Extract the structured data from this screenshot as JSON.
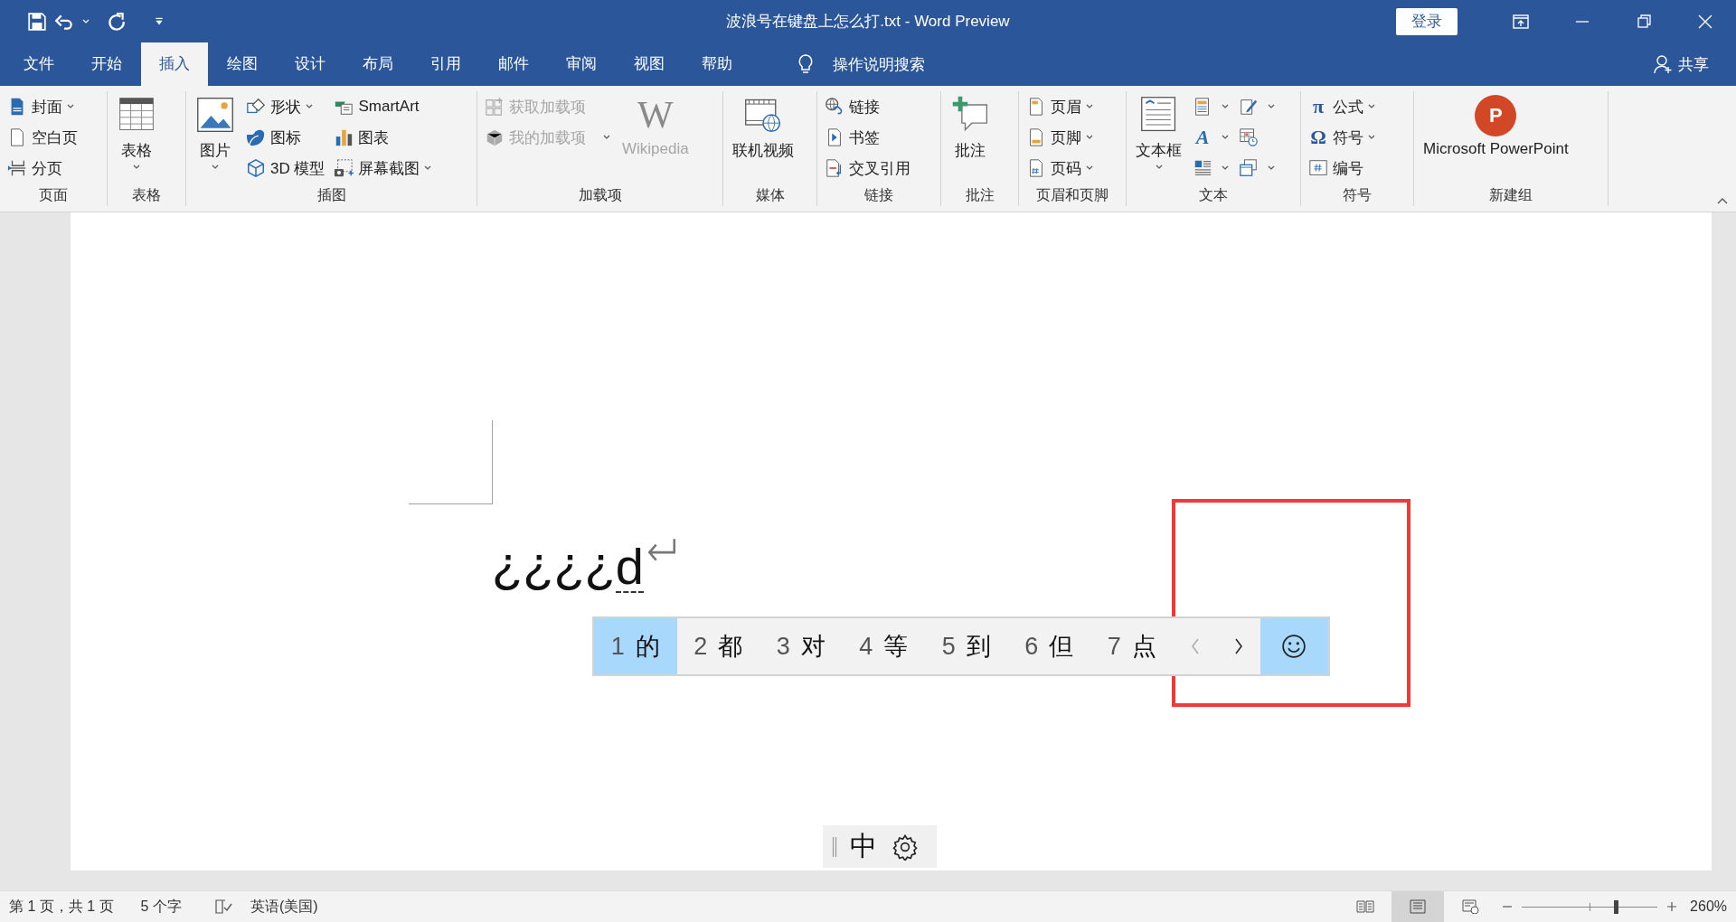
{
  "window": {
    "title": "波浪号在键盘上怎么打.txt  -  Word Preview",
    "sign_in": "登录"
  },
  "tabs": [
    {
      "label": "文件",
      "selected": false
    },
    {
      "label": "开始",
      "selected": false
    },
    {
      "label": "插入",
      "selected": true
    },
    {
      "label": "绘图",
      "selected": false
    },
    {
      "label": "设计",
      "selected": false
    },
    {
      "label": "布局",
      "selected": false
    },
    {
      "label": "引用",
      "selected": false
    },
    {
      "label": "邮件",
      "selected": false
    },
    {
      "label": "审阅",
      "selected": false
    },
    {
      "label": "视图",
      "selected": false
    },
    {
      "label": "帮助",
      "selected": false
    }
  ],
  "tell_me": "操作说明搜索",
  "share": "共享",
  "ribbon": {
    "groups": [
      {
        "label": "页面",
        "items": [
          {
            "kind": "small",
            "label": "封面",
            "dropdown": true,
            "disabled": false
          },
          {
            "kind": "small",
            "label": "空白页",
            "dropdown": false,
            "disabled": false
          },
          {
            "kind": "small",
            "label": "分页",
            "dropdown": false,
            "disabled": false
          }
        ]
      },
      {
        "label": "表格",
        "items": [
          {
            "kind": "large",
            "label": "表格",
            "dropdown": true,
            "disabled": false
          }
        ]
      },
      {
        "label": "插图",
        "items": [
          {
            "kind": "large",
            "label": "图片",
            "dropdown": true,
            "disabled": false
          },
          {
            "kind": "small",
            "label": "形状",
            "dropdown": true,
            "disabled": false
          },
          {
            "kind": "small",
            "label": "图标",
            "dropdown": false,
            "disabled": false
          },
          {
            "kind": "small",
            "label": "3D 模型",
            "dropdown": false,
            "disabled": false
          },
          {
            "kind": "small",
            "label": "SmartArt",
            "dropdown": false,
            "disabled": false
          },
          {
            "kind": "small",
            "label": "图表",
            "dropdown": false,
            "disabled": false
          },
          {
            "kind": "small",
            "label": "屏幕截图",
            "dropdown": true,
            "disabled": false
          }
        ]
      },
      {
        "label": "加载项",
        "items": [
          {
            "kind": "small",
            "label": "获取加载项",
            "dropdown": false,
            "disabled": true
          },
          {
            "kind": "small",
            "label": "我的加载项",
            "dropdown": true,
            "disabled": true
          },
          {
            "kind": "large",
            "label": "Wikipedia",
            "glyph": "W",
            "dropdown": false,
            "disabled": true
          }
        ]
      },
      {
        "label": "媒体",
        "items": [
          {
            "kind": "large",
            "label": "联机视频",
            "dropdown": false,
            "disabled": false
          }
        ]
      },
      {
        "label": "链接",
        "items": [
          {
            "kind": "small",
            "label": "链接",
            "dropdown": false,
            "disabled": false
          },
          {
            "kind": "small",
            "label": "书签",
            "dropdown": false,
            "disabled": false
          },
          {
            "kind": "small",
            "label": "交叉引用",
            "dropdown": false,
            "disabled": false
          }
        ]
      },
      {
        "label": "批注",
        "items": [
          {
            "kind": "large",
            "label": "批注",
            "dropdown": false,
            "disabled": false
          }
        ]
      },
      {
        "label": "页眉和页脚",
        "items": [
          {
            "kind": "small",
            "label": "页眉",
            "dropdown": true,
            "disabled": false
          },
          {
            "kind": "small",
            "label": "页脚",
            "dropdown": true,
            "disabled": false
          },
          {
            "kind": "small",
            "label": "页码",
            "dropdown": true,
            "disabled": false
          }
        ]
      },
      {
        "label": "文本",
        "items": [
          {
            "kind": "large",
            "label": "文本框",
            "dropdown": true,
            "disabled": false
          },
          {
            "kind": "icon",
            "dropdown": true,
            "disabled": false
          },
          {
            "kind": "icon",
            "glyph": "A",
            "dropdown": true,
            "disabled": false
          },
          {
            "kind": "icon",
            "dropdown": true,
            "disabled": false
          },
          {
            "kind": "icon",
            "dropdown": true,
            "disabled": false
          },
          {
            "kind": "icon",
            "dropdown": false,
            "disabled": false
          },
          {
            "kind": "icon",
            "dropdown": true,
            "disabled": false
          }
        ]
      },
      {
        "label": "符号",
        "items": [
          {
            "kind": "small",
            "label": "公式",
            "glyph": "π",
            "dropdown": true,
            "disabled": false
          },
          {
            "kind": "small",
            "label": "符号",
            "glyph": "Ω",
            "dropdown": true,
            "disabled": false
          },
          {
            "kind": "small",
            "label": "编号",
            "dropdown": false,
            "disabled": false
          }
        ]
      },
      {
        "label": "新建组",
        "items": [
          {
            "kind": "large",
            "label": "Microsoft PowerPoint",
            "glyph": "P",
            "dropdown": false,
            "disabled": false
          }
        ]
      }
    ]
  },
  "document": {
    "text": "¿¿¿¿",
    "composing": "d"
  },
  "candidates": {
    "items": [
      {
        "index": "1",
        "text": "的",
        "selected": true
      },
      {
        "index": "2",
        "text": "都",
        "selected": false
      },
      {
        "index": "3",
        "text": "对",
        "selected": false
      },
      {
        "index": "4",
        "text": "等",
        "selected": false
      },
      {
        "index": "5",
        "text": "到",
        "selected": false
      },
      {
        "index": "6",
        "text": "但",
        "selected": false
      },
      {
        "index": "7",
        "text": "点",
        "selected": false
      }
    ],
    "prev_disabled": true,
    "next_disabled": false,
    "emoji_selected": true
  },
  "ime_bar": {
    "mode": "中"
  },
  "status_bar": {
    "page": "第 1 页，共 1 页",
    "words": "5 个字",
    "language": "英语(美国)",
    "views": [
      {
        "selected": false
      },
      {
        "selected": true
      },
      {
        "selected": false
      }
    ],
    "zoom": {
      "level": 0.69,
      "reading": "260%"
    }
  }
}
